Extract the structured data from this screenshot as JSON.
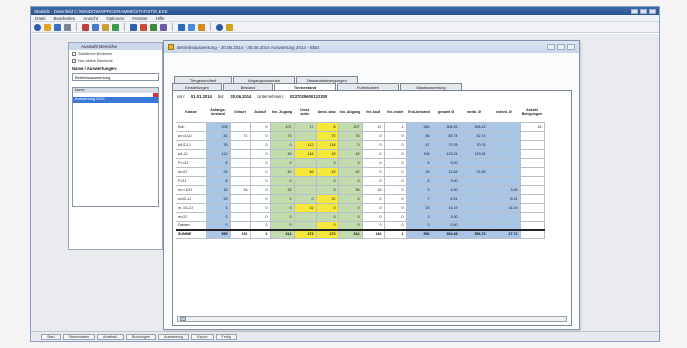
{
  "app": {
    "title": "Statistik - Datenfeld C:\\WINDOWS\\PROGRAMME\\STATISTIK.EXE",
    "menu": [
      "Datei",
      "Bearbeiten",
      "Ansicht",
      "Optionen",
      "Fenster",
      "Hilfe"
    ]
  },
  "side_panel": {
    "title": "Auswahl Bereiche",
    "option1": "Sämtliche Bereiche",
    "option2": "Nur aktive Bereiche",
    "label": "Name / Auswertungen:",
    "field_value": "Betriebsauswertung",
    "list_header": "Name",
    "selected_item": "Auswertung 2014"
  },
  "doc": {
    "title": "Betriebsauswertung - 30.06.2014 - 30.06.2014 Auswertung 2014 - Blatt",
    "tabs_row1": [
      "Tiergesundheit",
      "Abgangsursachen",
      "Bestandsbewegungen"
    ],
    "tabs_row2": [
      "Einstellungen",
      "Bestand",
      "Tierbestand",
      "Futterkosten",
      "Mastauswertung"
    ],
    "active_tab": "Tierbestand",
    "info": {
      "von_label": "von:",
      "von": "01.01.2014",
      "bis_label": "bis:",
      "bis": "30.06.2014",
      "unternehmen_label": "Unternehmen:",
      "unternehmen": "0237025600122300"
    },
    "columns": [
      "Klasse",
      "Anfangs-bestand",
      "Geburt",
      "Zukauf",
      "Inn. Zugang",
      "Umst. aufw.",
      "Umst. abw.",
      "Inn. Abgang",
      "Ver-kauf",
      "Ver-endet",
      "End-bestand",
      "gesamt Ø",
      "weibl. Ø",
      "männl. Ø",
      "Anzahl Belegungen"
    ],
    "rows": [
      {
        "k": "Kuh",
        "v": [
          "209",
          "",
          "0",
          "107",
          "17",
          "8",
          "107",
          "47",
          "1",
          "384",
          "304.26",
          "308.18",
          "",
          "16"
        ]
      },
      {
        "k": "w>=1/2J",
        "v": [
          "82",
          "71",
          "0",
          "73",
          "",
          "70",
          "78",
          "0",
          "0",
          "46",
          "83.74",
          "42.74",
          "",
          ""
        ]
      },
      {
        "k": "w1/2-1J",
        "v": [
          "39",
          "",
          "0",
          "0",
          "112",
          "116",
          "0",
          "0",
          "0",
          "47",
          "70.76",
          "70.76",
          "",
          ""
        ]
      },
      {
        "k": "w1-2J",
        "v": [
          "112",
          "",
          "0",
          "49",
          "116",
          "49",
          "49",
          "0",
          "0",
          "106",
          "129.24",
          "129.24",
          "",
          ""
        ]
      },
      {
        "k": "F>=2J",
        "v": [
          "6",
          "",
          "0",
          "0",
          "",
          "0",
          "0",
          "0",
          "0",
          "6",
          "5.00",
          "",
          "",
          ""
        ]
      },
      {
        "k": "m<2J",
        "v": [
          "29",
          "",
          "0",
          "40",
          "46",
          "43",
          "40",
          "0",
          "0",
          "29",
          "21.63",
          "21.63",
          "",
          ""
        ]
      },
      {
        "k": "F<2J",
        "v": [
          "8",
          "",
          "0",
          "0",
          "",
          "0",
          "0",
          "0",
          "0",
          "8",
          "3.00",
          "",
          "",
          ""
        ]
      },
      {
        "k": "m>=1/2J",
        "v": [
          "18",
          "34",
          "0",
          "33",
          "",
          "0",
          "36",
          "16",
          "0",
          "3",
          "4.50",
          "",
          "3.05",
          ""
        ]
      },
      {
        "k": "m1/2-1J",
        "v": [
          "29",
          "",
          "0",
          "0",
          "0",
          "22",
          "0",
          "0",
          "0",
          "7",
          "8.31",
          "",
          "8.31",
          ""
        ]
      },
      {
        "k": "m. 1/1-2J",
        "v": [
          "3",
          "",
          "0",
          "0",
          "22",
          "0",
          "0",
          "0",
          "0",
          "25",
          "14.19",
          "",
          "14.19",
          ""
        ]
      },
      {
        "k": "m>2J",
        "v": [
          "3",
          "",
          "0",
          "0",
          "",
          "0",
          "0",
          "0",
          "0",
          "3",
          "3.00",
          "",
          "",
          ""
        ]
      },
      {
        "k": "Damen",
        "v": [
          "0",
          "",
          "0",
          "0",
          "",
          "0",
          "0",
          "0",
          "0",
          "0",
          "0.00",
          "",
          "",
          ""
        ]
      }
    ],
    "sum": {
      "k": "SUMME",
      "v": [
        "555",
        "151",
        "0",
        "314",
        "273",
        "273",
        "314",
        "182",
        "1",
        "550",
        "564.28",
        "556.73",
        "27.72",
        ""
      ]
    }
  },
  "statusbar": {
    "buttons": [
      "Start",
      "Stammdaten",
      "Arbeitsbl.",
      "Buchungen",
      "Auswertung",
      "Export",
      "Fertig"
    ]
  },
  "colors": {
    "blue": "#a9c6e8",
    "green": "#c3dcae",
    "yellow": "#f5e83a"
  }
}
